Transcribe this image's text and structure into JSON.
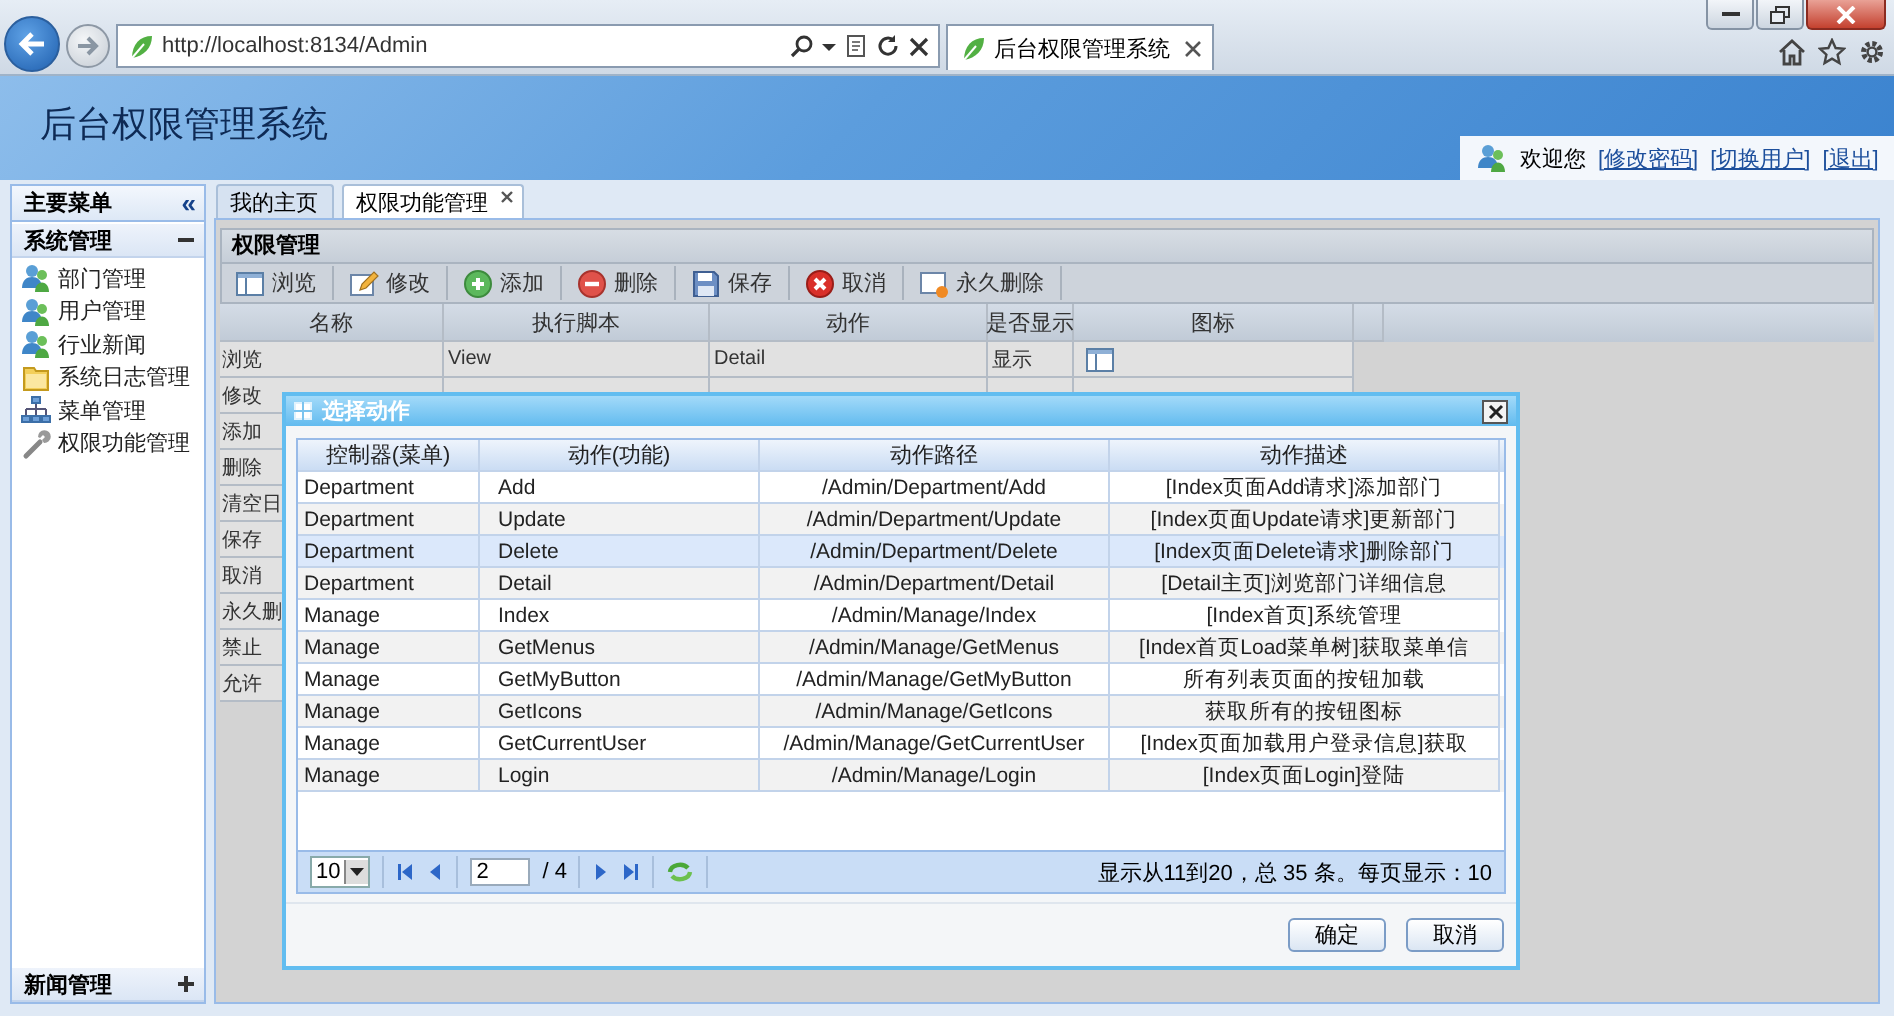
{
  "browser": {
    "address": "http://localhost:8134/Admin",
    "tab_title": "后台权限管理系统"
  },
  "header": {
    "title": "后台权限管理系统",
    "welcome": "欢迎您",
    "links": [
      "[修改密码]",
      "[切换用户]",
      "[退出]"
    ]
  },
  "sidebar": {
    "title": "主要菜单",
    "collapse": "«",
    "groups": [
      {
        "label": "系统管理",
        "expanded": true,
        "items": [
          {
            "label": "部门管理",
            "kind": "users"
          },
          {
            "label": "用户管理",
            "kind": "users"
          },
          {
            "label": "行业新闻",
            "kind": "users"
          },
          {
            "label": "系统日志管理",
            "kind": "log"
          },
          {
            "label": "菜单管理",
            "kind": "tree"
          },
          {
            "label": "权限功能管理",
            "kind": "wrench"
          }
        ]
      },
      {
        "label": "新闻管理",
        "expanded": false
      }
    ]
  },
  "main": {
    "tabs": [
      {
        "label": "我的主页",
        "selected": false,
        "closable": false
      },
      {
        "label": "权限功能管理",
        "selected": true,
        "closable": true
      }
    ],
    "panel_title": "权限管理",
    "toolbar": [
      {
        "label": "浏览",
        "kind": "view"
      },
      {
        "label": "修改",
        "kind": "edit"
      },
      {
        "label": "添加",
        "kind": "add"
      },
      {
        "label": "删除",
        "kind": "delete"
      },
      {
        "label": "保存",
        "kind": "save"
      },
      {
        "label": "取消",
        "kind": "cancel"
      },
      {
        "label": "永久删除",
        "kind": "purge"
      }
    ],
    "table": {
      "columns": [
        "名称",
        "执行脚本",
        "动作",
        "是否显示",
        "图标"
      ],
      "rows": [
        {
          "cells": [
            "浏览",
            "View",
            "Detail",
            "显示"
          ],
          "kind": "view"
        },
        {
          "cells": [
            "修改"
          ]
        },
        {
          "cells": [
            "添加"
          ]
        },
        {
          "cells": [
            "删除"
          ]
        },
        {
          "cells": [
            "清空日"
          ]
        },
        {
          "cells": [
            "保存"
          ]
        },
        {
          "cells": [
            "取消"
          ]
        },
        {
          "cells": [
            "永久删"
          ]
        },
        {
          "cells": [
            "禁止"
          ]
        },
        {
          "cells": [
            "允许"
          ]
        }
      ]
    }
  },
  "dialog": {
    "title": "选择动作",
    "columns": [
      "控制器(菜单)",
      "动作(功能)",
      "动作路径",
      "动作描述"
    ],
    "rows": [
      {
        "cells": [
          "Department",
          "Add",
          "/Admin/Department/Add",
          "[Index页面Add请求]添加部门"
        ],
        "selected": false
      },
      {
        "cells": [
          "Department",
          "Update",
          "/Admin/Department/Update",
          "[Index页面Update请求]更新部门"
        ],
        "selected": false
      },
      {
        "cells": [
          "Department",
          "Delete",
          "/Admin/Department/Delete",
          "[Index页面Delete请求]删除部门"
        ],
        "selected": true
      },
      {
        "cells": [
          "Department",
          "Detail",
          "/Admin/Department/Detail",
          "[Detail主页]浏览部门详细信息"
        ],
        "selected": false
      },
      {
        "cells": [
          "Manage",
          "Index",
          "/Admin/Manage/Index",
          "[Index首页]系统管理"
        ],
        "selected": false
      },
      {
        "cells": [
          "Manage",
          "GetMenus",
          "/Admin/Manage/GetMenus",
          "[Index首页Load菜单树]获取菜单信"
        ],
        "selected": false
      },
      {
        "cells": [
          "Manage",
          "GetMyButton",
          "/Admin/Manage/GetMyButton",
          "所有列表页面的按钮加载"
        ],
        "selected": false
      },
      {
        "cells": [
          "Manage",
          "GetIcons",
          "/Admin/Manage/GetIcons",
          "获取所有的按钮图标"
        ],
        "selected": false
      },
      {
        "cells": [
          "Manage",
          "GetCurrentUser",
          "/Admin/Manage/GetCurrentUser",
          "[Index页面加载用户登录信息]获取"
        ],
        "selected": false
      },
      {
        "cells": [
          "Manage",
          "Login",
          "/Admin/Manage/Login",
          "[Index页面Login]登陆"
        ],
        "selected": false
      }
    ],
    "pager": {
      "page_size": "10",
      "page": "2",
      "page_total": "/ 4",
      "summary": "显示从11到20，总 35 条。每页显示：10"
    },
    "buttons": [
      "确定",
      "取消"
    ]
  }
}
